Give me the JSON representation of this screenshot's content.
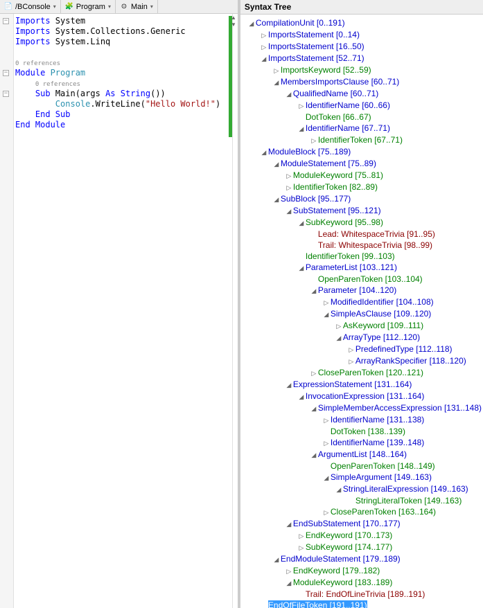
{
  "nav": {
    "items": [
      {
        "icon": "📄",
        "label": "/BConsole"
      },
      {
        "icon": "🧩",
        "label": "Program"
      },
      {
        "icon": "⊙",
        "label": "Main"
      }
    ]
  },
  "code": {
    "lines": [
      {
        "indent": 0,
        "tokens": [
          {
            "t": "Imports ",
            "c": "kw"
          },
          {
            "t": "System",
            "c": ""
          }
        ]
      },
      {
        "indent": 0,
        "tokens": [
          {
            "t": "Imports ",
            "c": "kw"
          },
          {
            "t": "System.Collections.Generic",
            "c": ""
          }
        ]
      },
      {
        "indent": 0,
        "tokens": [
          {
            "t": "Imports ",
            "c": "kw"
          },
          {
            "t": "System.Linq",
            "c": ""
          }
        ]
      },
      {
        "indent": 0,
        "tokens": []
      },
      {
        "indent": 0,
        "ref": true,
        "tokens": [
          {
            "t": "0 references",
            "c": "ref"
          }
        ]
      },
      {
        "indent": 0,
        "tokens": [
          {
            "t": "Module ",
            "c": "kw"
          },
          {
            "t": "Program",
            "c": "type"
          }
        ]
      },
      {
        "indent": 1,
        "ref": true,
        "tokens": [
          {
            "t": "0 references",
            "c": "ref"
          }
        ]
      },
      {
        "indent": 1,
        "tokens": [
          {
            "t": "Sub ",
            "c": "kw"
          },
          {
            "t": "Main(args ",
            "c": ""
          },
          {
            "t": "As ",
            "c": "kw"
          },
          {
            "t": "String",
            "c": "kw"
          },
          {
            "t": "())",
            "c": ""
          }
        ]
      },
      {
        "indent": 2,
        "tokens": [
          {
            "t": "Console",
            "c": "type"
          },
          {
            "t": ".WriteLine(",
            "c": ""
          },
          {
            "t": "\"Hello World!\"",
            "c": "str"
          },
          {
            "t": ")",
            "c": ""
          }
        ]
      },
      {
        "indent": 1,
        "tokens": [
          {
            "t": "End Sub",
            "c": "kw"
          }
        ]
      },
      {
        "indent": 0,
        "tokens": [
          {
            "t": "End Module",
            "c": "kw"
          }
        ]
      }
    ],
    "outline_toggles": [
      {
        "line": 0,
        "sym": "−"
      },
      {
        "line": 5,
        "sym": "−"
      },
      {
        "line": 7,
        "sym": "−"
      }
    ]
  },
  "syntax_tree": {
    "title": "Syntax Tree",
    "root": {
      "label": "CompilationUnit [0..191)",
      "color": "c-blue",
      "expanded": true,
      "children": [
        {
          "label": "ImportsStatement [0..14)",
          "color": "c-blue",
          "expanded": false,
          "children": []
        },
        {
          "label": "ImportsStatement [16..50)",
          "color": "c-blue",
          "expanded": false,
          "children": []
        },
        {
          "label": "ImportsStatement [52..71)",
          "color": "c-blue",
          "expanded": true,
          "children": [
            {
              "label": "ImportsKeyword [52..59)",
              "color": "c-green",
              "expanded": false,
              "children": []
            },
            {
              "label": "MembersImportsClause [60..71)",
              "color": "c-blue",
              "expanded": true,
              "children": [
                {
                  "label": "QualifiedName [60..71)",
                  "color": "c-blue",
                  "expanded": true,
                  "children": [
                    {
                      "label": "IdentifierName [60..66)",
                      "color": "c-blue",
                      "expanded": false,
                      "children": []
                    },
                    {
                      "label": "DotToken [66..67)",
                      "color": "c-green",
                      "leaf": true
                    },
                    {
                      "label": "IdentifierName [67..71)",
                      "color": "c-blue",
                      "expanded": true,
                      "children": [
                        {
                          "label": "IdentifierToken [67..71)",
                          "color": "c-green",
                          "expanded": false,
                          "children": []
                        }
                      ]
                    }
                  ]
                }
              ]
            }
          ]
        },
        {
          "label": "ModuleBlock [75..189)",
          "color": "c-blue",
          "expanded": true,
          "children": [
            {
              "label": "ModuleStatement [75..89)",
              "color": "c-blue",
              "expanded": true,
              "children": [
                {
                  "label": "ModuleKeyword [75..81)",
                  "color": "c-green",
                  "expanded": false,
                  "children": []
                },
                {
                  "label": "IdentifierToken [82..89)",
                  "color": "c-green",
                  "expanded": false,
                  "children": []
                }
              ]
            },
            {
              "label": "SubBlock [95..177)",
              "color": "c-blue",
              "expanded": true,
              "children": [
                {
                  "label": "SubStatement [95..121)",
                  "color": "c-blue",
                  "expanded": true,
                  "children": [
                    {
                      "label": "SubKeyword [95..98)",
                      "color": "c-green",
                      "expanded": true,
                      "children": [
                        {
                          "label": "Lead: WhitespaceTrivia [91..95)",
                          "color": "c-darkred",
                          "leaf": true
                        },
                        {
                          "label": "Trail: WhitespaceTrivia [98..99)",
                          "color": "c-darkred",
                          "leaf": true
                        }
                      ]
                    },
                    {
                      "label": "IdentifierToken [99..103)",
                      "color": "c-green",
                      "leaf": true
                    },
                    {
                      "label": "ParameterList [103..121)",
                      "color": "c-blue",
                      "expanded": true,
                      "children": [
                        {
                          "label": "OpenParenToken [103..104)",
                          "color": "c-green",
                          "leaf": true
                        },
                        {
                          "label": "Parameter [104..120)",
                          "color": "c-blue",
                          "expanded": true,
                          "children": [
                            {
                              "label": "ModifiedIdentifier [104..108)",
                              "color": "c-blue",
                              "expanded": false,
                              "children": []
                            },
                            {
                              "label": "SimpleAsClause [109..120)",
                              "color": "c-blue",
                              "expanded": true,
                              "children": [
                                {
                                  "label": "AsKeyword [109..111)",
                                  "color": "c-green",
                                  "expanded": false,
                                  "children": []
                                },
                                {
                                  "label": "ArrayType [112..120)",
                                  "color": "c-blue",
                                  "expanded": true,
                                  "children": [
                                    {
                                      "label": "PredefinedType [112..118)",
                                      "color": "c-blue",
                                      "expanded": false,
                                      "children": []
                                    },
                                    {
                                      "label": "ArrayRankSpecifier [118..120)",
                                      "color": "c-blue",
                                      "expanded": false,
                                      "children": []
                                    }
                                  ]
                                }
                              ]
                            }
                          ]
                        },
                        {
                          "label": "CloseParenToken [120..121)",
                          "color": "c-green",
                          "expanded": false,
                          "children": []
                        }
                      ]
                    }
                  ]
                },
                {
                  "label": "ExpressionStatement [131..164)",
                  "color": "c-blue",
                  "expanded": true,
                  "children": [
                    {
                      "label": "InvocationExpression [131..164)",
                      "color": "c-blue",
                      "expanded": true,
                      "children": [
                        {
                          "label": "SimpleMemberAccessExpression [131..148)",
                          "color": "c-blue",
                          "expanded": true,
                          "children": [
                            {
                              "label": "IdentifierName [131..138)",
                              "color": "c-blue",
                              "expanded": false,
                              "children": []
                            },
                            {
                              "label": "DotToken [138..139)",
                              "color": "c-green",
                              "leaf": true
                            },
                            {
                              "label": "IdentifierName [139..148)",
                              "color": "c-blue",
                              "expanded": false,
                              "children": []
                            }
                          ]
                        },
                        {
                          "label": "ArgumentList [148..164)",
                          "color": "c-blue",
                          "expanded": true,
                          "children": [
                            {
                              "label": "OpenParenToken [148..149)",
                              "color": "c-green",
                              "leaf": true
                            },
                            {
                              "label": "SimpleArgument [149..163)",
                              "color": "c-blue",
                              "expanded": true,
                              "children": [
                                {
                                  "label": "StringLiteralExpression [149..163)",
                                  "color": "c-blue",
                                  "expanded": true,
                                  "children": [
                                    {
                                      "label": "StringLiteralToken [149..163)",
                                      "color": "c-green",
                                      "leaf": true
                                    }
                                  ]
                                }
                              ]
                            },
                            {
                              "label": "CloseParenToken [163..164)",
                              "color": "c-green",
                              "expanded": false,
                              "children": []
                            }
                          ]
                        }
                      ]
                    }
                  ]
                },
                {
                  "label": "EndSubStatement [170..177)",
                  "color": "c-blue",
                  "expanded": true,
                  "children": [
                    {
                      "label": "EndKeyword [170..173)",
                      "color": "c-green",
                      "expanded": false,
                      "children": []
                    },
                    {
                      "label": "SubKeyword [174..177)",
                      "color": "c-green",
                      "expanded": false,
                      "children": []
                    }
                  ]
                }
              ]
            },
            {
              "label": "EndModuleStatement [179..189)",
              "color": "c-blue",
              "expanded": true,
              "children": [
                {
                  "label": "EndKeyword [179..182)",
                  "color": "c-green",
                  "expanded": false,
                  "children": []
                },
                {
                  "label": "ModuleKeyword [183..189)",
                  "color": "c-green",
                  "expanded": true,
                  "children": [
                    {
                      "label": "Trail: EndOfLineTrivia [189..191)",
                      "color": "c-darkred",
                      "leaf": true
                    }
                  ]
                }
              ]
            }
          ]
        },
        {
          "label": "EndOfFileToken [191..191)",
          "color": "c-green",
          "leaf": true,
          "selected": true
        }
      ]
    }
  }
}
